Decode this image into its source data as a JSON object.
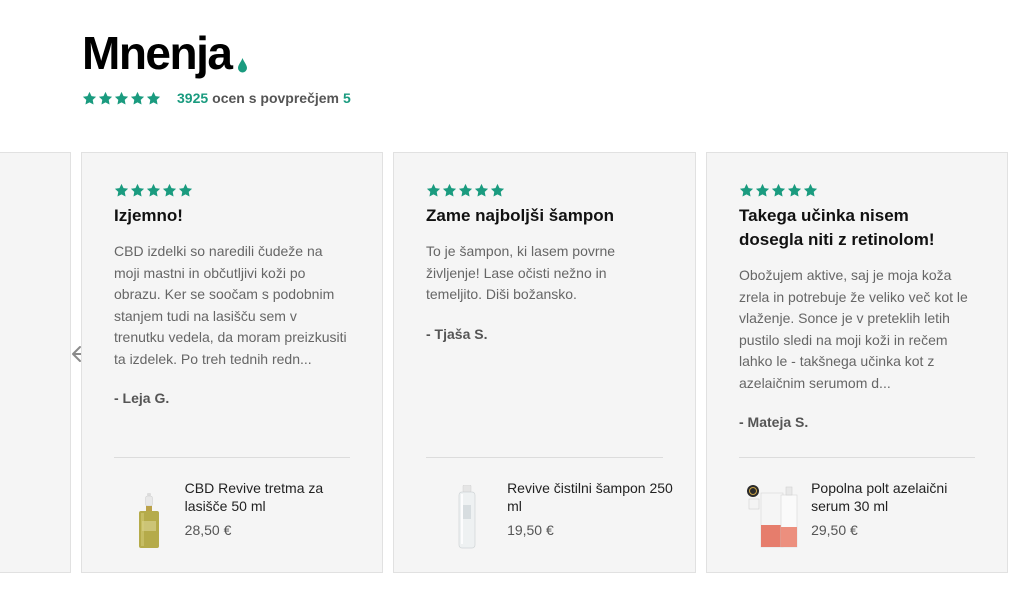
{
  "section": {
    "title": "Mnenja",
    "rating_count": "3925",
    "rating_text": "ocen s povprečjem",
    "rating_average": "5"
  },
  "colors": {
    "accent": "#1a9b7f",
    "card_bg": "#f5f5f5"
  },
  "icons": {
    "star": "star-icon",
    "drop": "drop-icon",
    "arrow": "arrow-left-icon"
  },
  "reviews": [
    {
      "stars": 5,
      "title": "Izjemno!",
      "text": "CBD izdelki so naredili čudeže na moji mastni in občutljivi koži po obrazu. Ker se soočam s podobnim stanjem tudi na lasišču sem v trenutku vedela, da moram preizkusiti ta izdelek. Po treh tednih redn...",
      "author": "- Leja G.",
      "product_name": "CBD Revive tretma za lasišče 50 ml",
      "product_price": "28,50 €"
    },
    {
      "stars": 5,
      "title": "Zame najboljši šampon",
      "text": "To je šampon, ki lasem povrne življenje! Lase očisti nežno in temeljito. Diši božansko.",
      "author": "- Tjaša S.",
      "product_name": "Revive čistilni šampon 250 ml",
      "product_price": "19,50 €"
    },
    {
      "stars": 5,
      "title": "Takega učinka nisem dosegla niti z retinolom!",
      "text": "Obožujem aktive, saj je moja koža zrela in potrebuje že veliko več kot le vlaženje. Sonce je v preteklih letih pustilo sledi na moji koži in rečem lahko le - takšnega učinka kot z azelaičnim serumom d...",
      "author": "- Mateja S.",
      "product_name": "Popolna polt azelaični serum 30 ml",
      "product_price": "29,50 €"
    }
  ]
}
